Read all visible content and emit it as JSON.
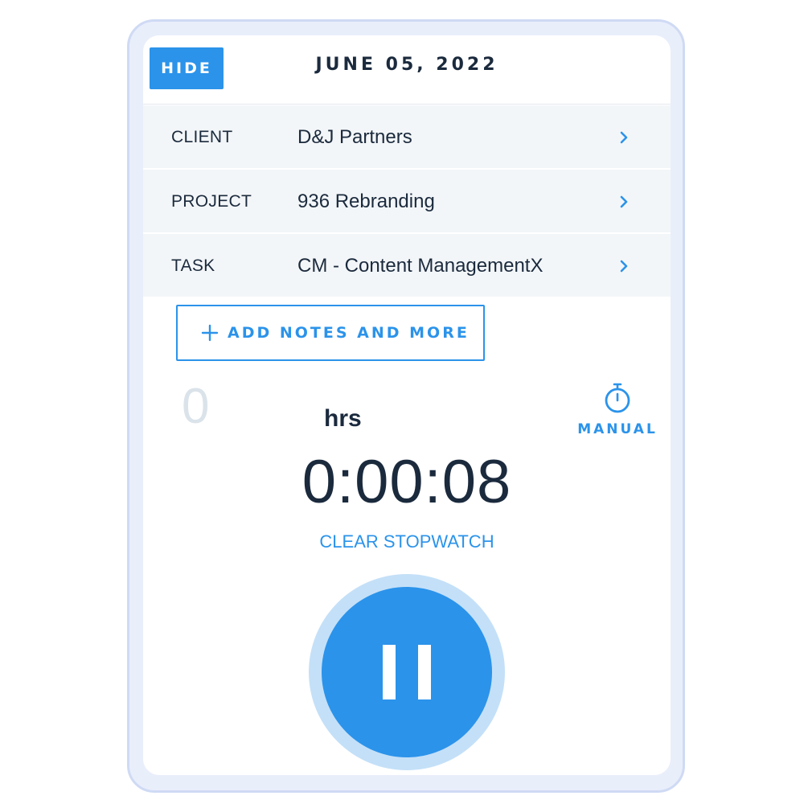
{
  "header": {
    "hide_label": "HIDE",
    "date": "JUNE 05, 2022"
  },
  "rows": [
    {
      "label": "CLIENT",
      "value": "D&J Partners",
      "icon": "chevron-right-icon"
    },
    {
      "label": "PROJECT",
      "value": "936 Rebranding",
      "icon": "chevron-right-icon"
    },
    {
      "label": "TASK",
      "value": "CM - Content ManagementX",
      "icon": "chevron-right-icon"
    }
  ],
  "notes": {
    "label": "ADD NOTES AND MORE",
    "icon": "plus-icon"
  },
  "entry": {
    "hours_value": "0",
    "hours_unit": "hrs",
    "manual_label": "MANUAL",
    "manual_icon": "stopwatch-icon"
  },
  "stopwatch": {
    "elapsed": "0:00:08",
    "clear_label": "CLEAR STOPWATCH",
    "control_icon": "pause-icon"
  },
  "colors": {
    "accent": "#2b93ea",
    "text": "#1b2a3d",
    "row_bg": "#f3f6f8",
    "halo": "#c4e0f8"
  }
}
